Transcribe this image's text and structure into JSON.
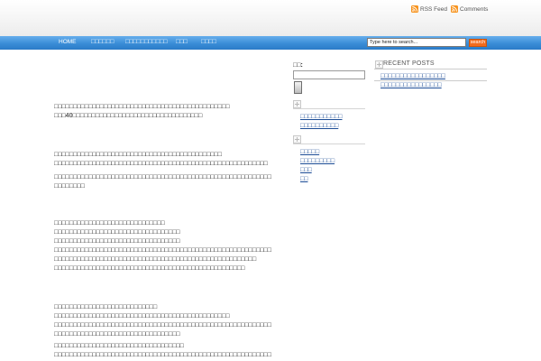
{
  "colors": {
    "nav-blue": "#3a8dd7",
    "search-orange": "#f26b1d",
    "rss-orange": "#f7931e",
    "link-blue": "#1c4c96",
    "text": "#111111"
  },
  "icons": {
    "feed": "rss-icon",
    "widget": "plus-box-icon"
  },
  "header": {
    "rss_feed_label": "RSS Feed",
    "comments_label": "Comments"
  },
  "nav": {
    "items": [
      "HOME",
      "□□□□□□",
      "□□□□□□□□□□□",
      "□□□",
      "□□□□"
    ],
    "search": {
      "value": "Type here to search...",
      "button_label": "search"
    }
  },
  "main": {
    "paragraphs": [
      {
        "lines": [
          "□□□□□□□□□□□□□□□□□□□□□□□□□□□□□□□□□□□□□□□□□□□□□□",
          "□□□40□□□□□□□□□□□□□□□□□□□□□□□□□□□□□□□□□□"
        ]
      },
      {
        "lines": [
          "□□□□□□□□□□□□□□□□□□□□□□□□□□□□□□□□□□□□□□□□□□□□",
          "□□□□□□□□□□□□□□□□□□□□□□□□□□□□□□□□□□□□□□□□□□□□□□□□□□□□□□□□"
        ]
      },
      {
        "lines": [
          "□□□□□□□□□□□□□□□□□□□□□□□□□□□□□□□□□□□□□□□□□□□□□□□□□□□□□□□□□",
          "□□□□□□□□"
        ]
      },
      {
        "lines": [
          "□□□□□□□□□□□□□□□□□□□□□□□□□□□□□",
          "□□□□□□□□□□□□□□□□□□□□□□□□□□□□□□□□□",
          "□□□□□□□□□□□□□□□□□□□□□□□□□□□□□□□□□",
          "□□□□□□□□□□□□□□□□□□□□□□□□□□□□□□□□□□□□□□□□□□□□□□□□□□□□□□□□□",
          "□□□□□□□□□□□□□□□□□□□□□□□□□□□□□□□□□□□□□□□□□□□□□□□□□□□□□",
          "□□□□□□□□□□□□□□□□□□□□□□□□□□□□□□□□□□□□□□□□□□□□□□□□□□"
        ]
      },
      {
        "lines": [
          "□□□□□□□□□□□□□□□□□□□□□□□□□□□",
          "□□□□□□□□□□□□□□□□□□□□□□□□□□□□□□□□□□□□□□□□□□□□□□",
          "□□□□□□□□□□□□□□□□□□□□□□□□□□□□□□□□□□□□□□□□□□□□□□□□□□□□□□□□□",
          "□□□□□□□□□□□□□□□□□□□□□□□□□□□□□□□□□"
        ]
      },
      {
        "lines": [
          "□□□□□□□□□□□□□□□□□□□□□□□□□□□□□□□□□□",
          "□□□□□□□□□□□□□□□□□□□□□□□□□□□□□□□□□□□□□□□□□□□□□□□□□□□□□□□□□"
        ]
      }
    ]
  },
  "sidebar_left": {
    "search_label": "□□:",
    "widgets": [
      {
        "links": [
          "□□□□□□□□□□□",
          "□□□□□□□□□□"
        ]
      },
      {
        "links": [
          "□□□□□",
          "□□□□□□□□□",
          "□□□",
          "□□"
        ]
      }
    ]
  },
  "sidebar_right": {
    "title": "RECENT POSTS",
    "links": [
      "□□□□□□□□□□□□□□□□□",
      "□□□□□□□□□□□□□□□□"
    ]
  }
}
